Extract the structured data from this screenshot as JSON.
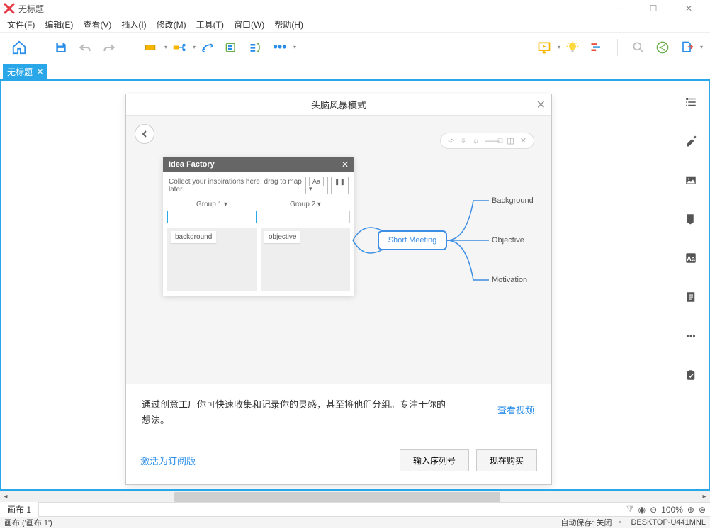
{
  "window": {
    "title": "无标题"
  },
  "menus": [
    "文件(F)",
    "编辑(E)",
    "查看(V)",
    "插入(I)",
    "修改(M)",
    "工具(T)",
    "窗口(W)",
    "帮助(H)"
  ],
  "tab": {
    "title": "无标题"
  },
  "dialog": {
    "title": "头脑风暴模式",
    "idea_factory": {
      "title": "Idea Factory",
      "hint": "Collect your inspirations here, drag to map later.",
      "aa": "Aa",
      "group1": "Group 1",
      "group2": "Group 2",
      "chip1": "background",
      "chip2": "objective"
    },
    "mindmap": {
      "center": "Short Meeting",
      "n1": "Background",
      "n2": "Objective",
      "n3": "Motivation"
    },
    "description": "通过创意工厂你可快速收集和记录你的灵感，甚至将他们分组。专注于你的想法。",
    "video_link": "查看视频",
    "activate": "激活为订阅版",
    "btn_serial": "输入序列号",
    "btn_buy": "现在购买"
  },
  "sheet": {
    "tab1": "画布 1"
  },
  "zoom": {
    "value": "100%"
  },
  "status": {
    "canvas": "画布  ('画布 1')",
    "autosave": "自动保存: 关闭",
    "host": "DESKTOP-U441MNL"
  }
}
